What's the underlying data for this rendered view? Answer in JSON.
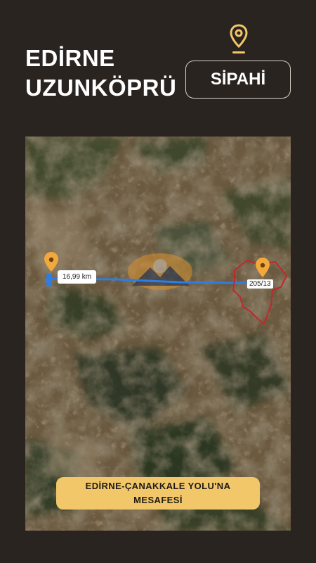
{
  "header": {
    "title_line1": "EDİRNE",
    "title_line2": "UZUNKÖPRÜ",
    "location_badge": "SİPAHİ",
    "pin_icon": "map-pin-icon",
    "accent_color": "#f2c76a"
  },
  "map": {
    "distance_label": "16,99 km",
    "parcel_label": "205/13",
    "route_color": "#2f7de1",
    "parcel_outline_color": "#c0282d",
    "pin_color": "#f2a93b",
    "caption": "EDİRNE-ÇANAKKALE YOLU'NA MESAFESİ"
  }
}
